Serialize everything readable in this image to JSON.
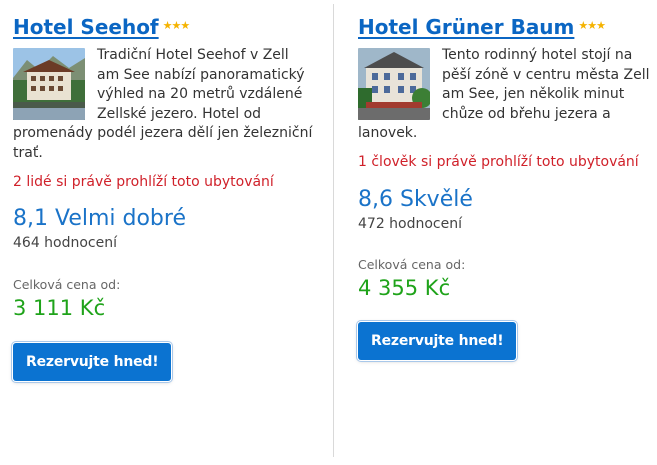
{
  "hotels": [
    {
      "name": "Hotel Seehof",
      "stars": "★★★",
      "description": "Tradiční Hotel Seehof v Zell am See nabízí panoramatický výhled na 20 metrů vzdálené Zellské jezero. Hotel od promenády podél jezera dělí jen železniční trať.",
      "viewing": "2 lidé si právě prohlíží toto ubytování",
      "rating": "8,1 Velmi dobré",
      "reviews": "464 hodnocení",
      "price_label": "Celková cena od:",
      "price": "3 111 Kč",
      "book_label": "Rezervujte hned!"
    },
    {
      "name": "Hotel Grüner Baum ",
      "stars": "★★★",
      "description": "Tento rodinný hotel stojí na pěší zóně v centru města Zell am See, jen několik minut chůze od břehu jezera a lanovek.",
      "viewing": "1 člověk si právě prohlíží toto ubytování",
      "rating": "8,6 Skvělé",
      "reviews": "472 hodnocení",
      "price_label": "Celková cena od:",
      "price": "4 355 Kč",
      "book_label": "Rezervujte hned!"
    }
  ],
  "colors": {
    "link": "#0b66c3",
    "stars": "#f5b301",
    "viewing": "#d0212a",
    "rating": "#1a73c8",
    "price": "#1fa31a",
    "button": "#0b73d1"
  }
}
